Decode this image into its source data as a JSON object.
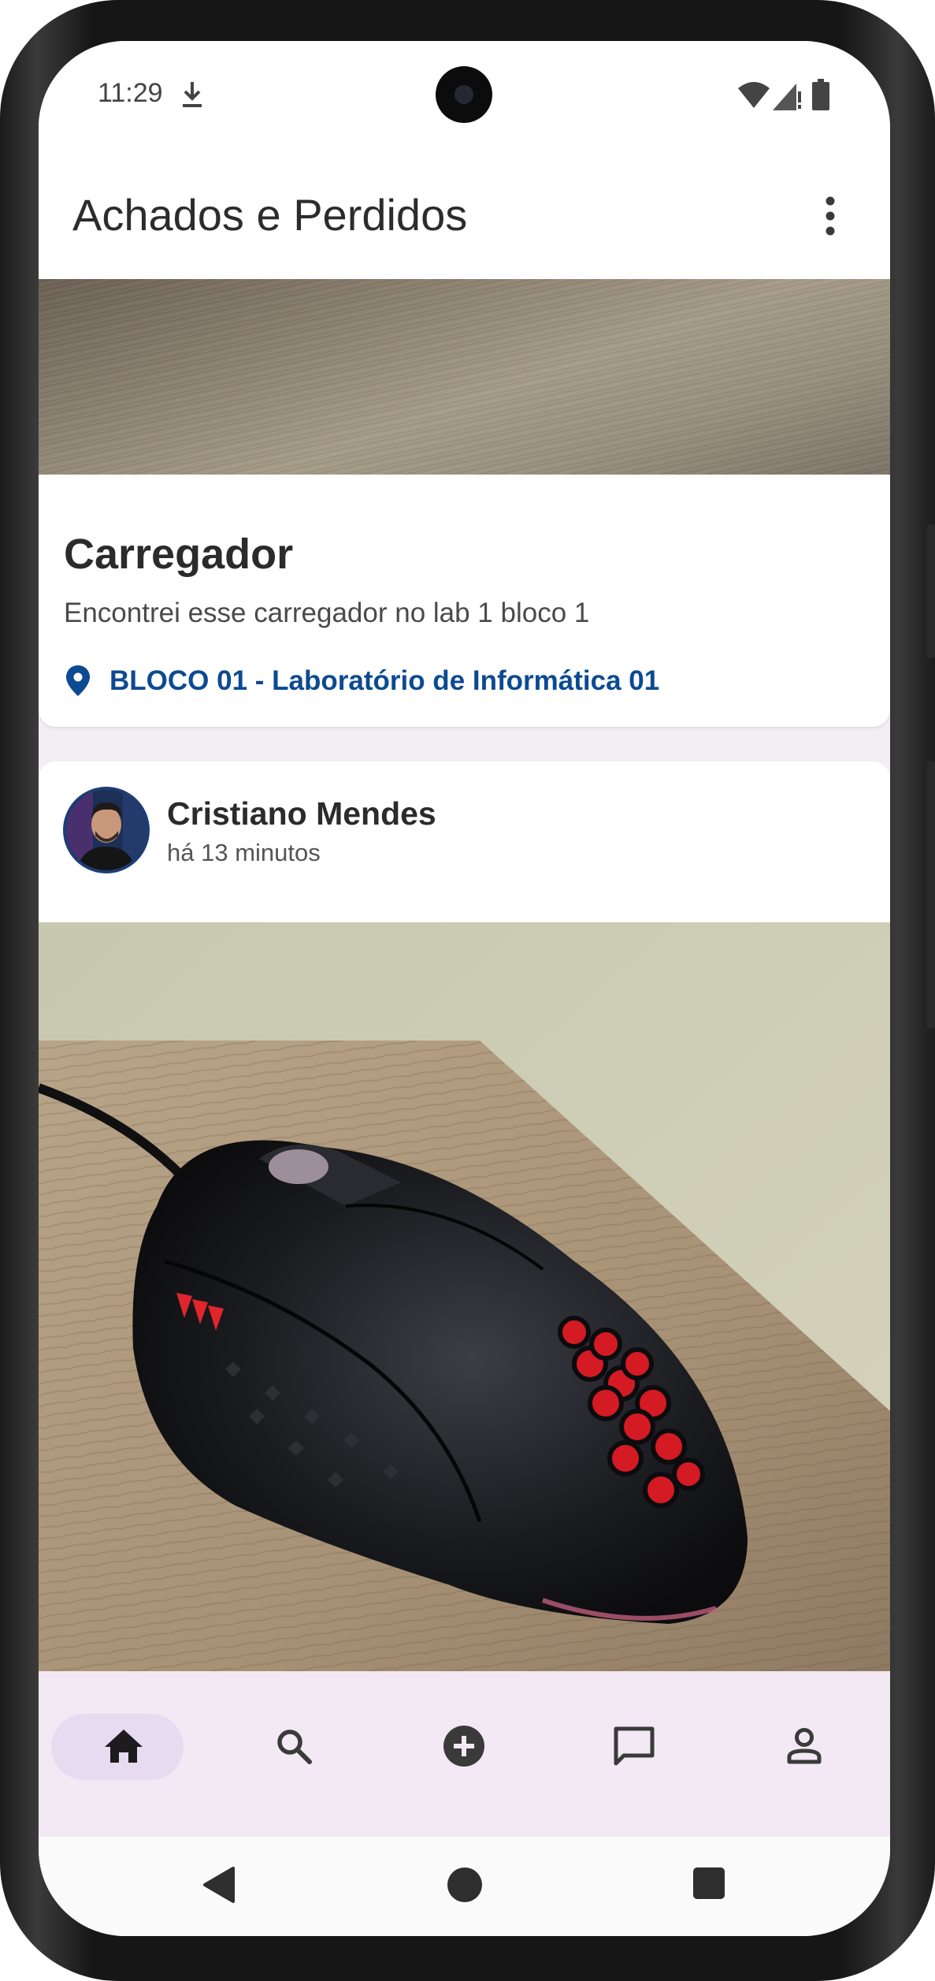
{
  "status_bar": {
    "time": "11:29",
    "icons": [
      "download-icon",
      "wifi-icon",
      "signal-icon",
      "battery-icon"
    ]
  },
  "app_bar": {
    "title": "Achados e Perdidos",
    "menu_icon": "more-vertical-icon"
  },
  "feed": {
    "posts": [
      {
        "image": "wooden-table-photo",
        "title": "Carregador",
        "description": "Encontrei esse carregador no lab 1 bloco 1",
        "location_icon": "location-pin-icon",
        "location": "BLOCO 01 - Laboratório de Informática 01"
      },
      {
        "author": "Cristiano Mendes",
        "time_ago": "há 13 minutos",
        "image": "black-gaming-mouse-photo"
      }
    ]
  },
  "bottom_nav": {
    "selected": "home",
    "items": [
      {
        "id": "home",
        "icon": "home-icon"
      },
      {
        "id": "search",
        "icon": "search-icon"
      },
      {
        "id": "add",
        "icon": "add-circle-icon"
      },
      {
        "id": "chat",
        "icon": "chat-icon"
      },
      {
        "id": "profile",
        "icon": "person-icon"
      }
    ]
  },
  "system_nav": [
    "back-icon",
    "home-circle-icon",
    "recents-icon"
  ],
  "colors": {
    "location_text": "#0c4a92",
    "bottom_nav_bg": "#f2e9f4",
    "nav_selected_pill": "#e7dbf1",
    "avatar_border": "#1d3d74"
  }
}
